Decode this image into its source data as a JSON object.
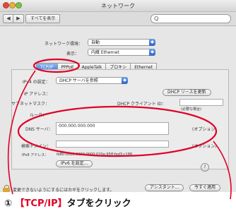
{
  "window": {
    "title": "ネットワーク"
  },
  "toolbar": {
    "back": "◀",
    "forward": "▶",
    "show_all": "すべてを表示",
    "search_glyph": "Q"
  },
  "settings": {
    "location_label": "ネットワーク環境：",
    "location_value": "自動",
    "show_label": "表示：",
    "show_value": "内蔵 Ethernet",
    "popup_arrow": "◆"
  },
  "tabs": [
    "TCP/IP",
    "PPPoE",
    "AppleTalk",
    "プロキシ",
    "Ethernet"
  ],
  "tcpip": {
    "ipv4_label": "IPv4 の設定：",
    "ipv4_value": "DHCP サーバを参照",
    "ip_label": "IP アドレス：",
    "dhcp_renew_button": "DHCP リースを更新",
    "subnet_label": "サブネットマスク：",
    "dhcp_client_id": "DHCP クライアント ID：",
    "if_required": "(必要な場合)",
    "router_label": "ルータ：",
    "dns_label": "DNS サーバ：",
    "dns_value": "000.000.000.000",
    "optional": "(オプション)",
    "search_domain_label": "検索ドメイン：",
    "optional2": "(オプション)",
    "ipv6_label": "IPv6 アドレス：",
    "ipv6_value": "fe80:0000:0000:0000:020a:95ff:fed3:c188",
    "ipv6_button": "IPv6 を設定...",
    "help": "?"
  },
  "footer": {
    "lock_text": "変更できないようにするにはカギをクリックします。",
    "assistant_button": "アシスタント...",
    "apply_button": "今すぐ適用"
  },
  "annotation": {
    "prefix": "① ",
    "highlight": "【TCP/IP】",
    "suffix": "タブをクリック"
  },
  "colors": {
    "annotation_red": "#e00026",
    "tab_selected": "#3b7ad9"
  }
}
